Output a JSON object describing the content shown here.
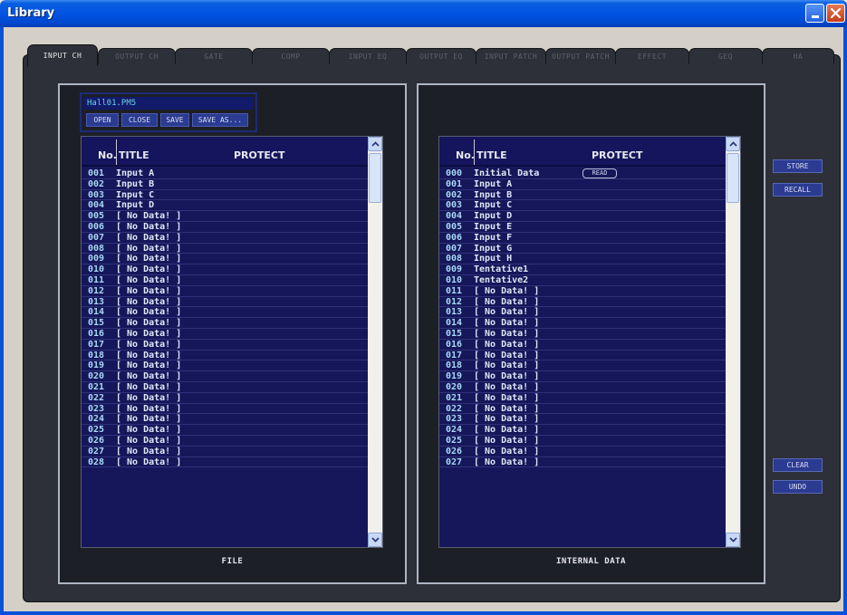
{
  "window": {
    "title": "Library"
  },
  "tabs": [
    {
      "label": "INPUT CH",
      "active": true
    },
    {
      "label": "OUTPUT CH",
      "active": false
    },
    {
      "label": "GATE",
      "active": false
    },
    {
      "label": "COMP",
      "active": false
    },
    {
      "label": "INPUT EQ",
      "active": false
    },
    {
      "label": "OUTPUT EQ",
      "active": false
    },
    {
      "label": "INPUT PATCH",
      "active": false
    },
    {
      "label": "OUTPUT PATCH",
      "active": false
    },
    {
      "label": "EFFECT",
      "active": false
    },
    {
      "label": "GEQ",
      "active": false
    },
    {
      "label": "HA",
      "active": false
    }
  ],
  "file": {
    "filename": "Hall01.PM5",
    "buttons": {
      "open": "OPEN",
      "close": "CLOSE",
      "save": "SAVE",
      "save_as": "SAVE AS..."
    },
    "panel_label": "FILE"
  },
  "internal": {
    "panel_label": "INTERNAL DATA"
  },
  "columns": {
    "no": "No.",
    "title": "TITLE",
    "protect": "PROTECT"
  },
  "side_buttons": {
    "store": "STORE",
    "recall": "RECALL",
    "clear": "CLEAR",
    "undo": "UNDO"
  },
  "file_rows": [
    {
      "no": "001",
      "title": "Input A"
    },
    {
      "no": "002",
      "title": "Input B"
    },
    {
      "no": "003",
      "title": "Input C"
    },
    {
      "no": "004",
      "title": "Input D"
    },
    {
      "no": "005",
      "title": "[ No Data! ]"
    },
    {
      "no": "006",
      "title": "[ No Data! ]"
    },
    {
      "no": "007",
      "title": "[ No Data! ]"
    },
    {
      "no": "008",
      "title": "[ No Data! ]"
    },
    {
      "no": "009",
      "title": "[ No Data! ]"
    },
    {
      "no": "010",
      "title": "[ No Data! ]"
    },
    {
      "no": "011",
      "title": "[ No Data! ]"
    },
    {
      "no": "012",
      "title": "[ No Data! ]"
    },
    {
      "no": "013",
      "title": "[ No Data! ]"
    },
    {
      "no": "014",
      "title": "[ No Data! ]"
    },
    {
      "no": "015",
      "title": "[ No Data! ]"
    },
    {
      "no": "016",
      "title": "[ No Data! ]"
    },
    {
      "no": "017",
      "title": "[ No Data! ]"
    },
    {
      "no": "018",
      "title": "[ No Data! ]"
    },
    {
      "no": "019",
      "title": "[ No Data! ]"
    },
    {
      "no": "020",
      "title": "[ No Data! ]"
    },
    {
      "no": "021",
      "title": "[ No Data! ]"
    },
    {
      "no": "022",
      "title": "[ No Data! ]"
    },
    {
      "no": "023",
      "title": "[ No Data! ]"
    },
    {
      "no": "024",
      "title": "[ No Data! ]"
    },
    {
      "no": "025",
      "title": "[ No Data! ]"
    },
    {
      "no": "026",
      "title": "[ No Data! ]"
    },
    {
      "no": "027",
      "title": "[ No Data! ]"
    },
    {
      "no": "028",
      "title": "[ No Data! ]"
    }
  ],
  "internal_rows": [
    {
      "no": "000",
      "title": "Initial Data",
      "protect": "READ"
    },
    {
      "no": "001",
      "title": "Input A"
    },
    {
      "no": "002",
      "title": "Input B"
    },
    {
      "no": "003",
      "title": "Input C"
    },
    {
      "no": "004",
      "title": "Input D"
    },
    {
      "no": "005",
      "title": "Input E"
    },
    {
      "no": "006",
      "title": "Input F"
    },
    {
      "no": "007",
      "title": "Input G"
    },
    {
      "no": "008",
      "title": "Input H"
    },
    {
      "no": "009",
      "title": "Tentative1"
    },
    {
      "no": "010",
      "title": "Tentative2"
    },
    {
      "no": "011",
      "title": "[ No Data! ]"
    },
    {
      "no": "012",
      "title": "[ No Data! ]"
    },
    {
      "no": "013",
      "title": "[ No Data! ]"
    },
    {
      "no": "014",
      "title": "[ No Data! ]"
    },
    {
      "no": "015",
      "title": "[ No Data! ]"
    },
    {
      "no": "016",
      "title": "[ No Data! ]"
    },
    {
      "no": "017",
      "title": "[ No Data! ]"
    },
    {
      "no": "018",
      "title": "[ No Data! ]"
    },
    {
      "no": "019",
      "title": "[ No Data! ]"
    },
    {
      "no": "020",
      "title": "[ No Data! ]"
    },
    {
      "no": "021",
      "title": "[ No Data! ]"
    },
    {
      "no": "022",
      "title": "[ No Data! ]"
    },
    {
      "no": "023",
      "title": "[ No Data! ]"
    },
    {
      "no": "024",
      "title": "[ No Data! ]"
    },
    {
      "no": "025",
      "title": "[ No Data! ]"
    },
    {
      "no": "026",
      "title": "[ No Data! ]"
    },
    {
      "no": "027",
      "title": "[ No Data! ]"
    }
  ]
}
